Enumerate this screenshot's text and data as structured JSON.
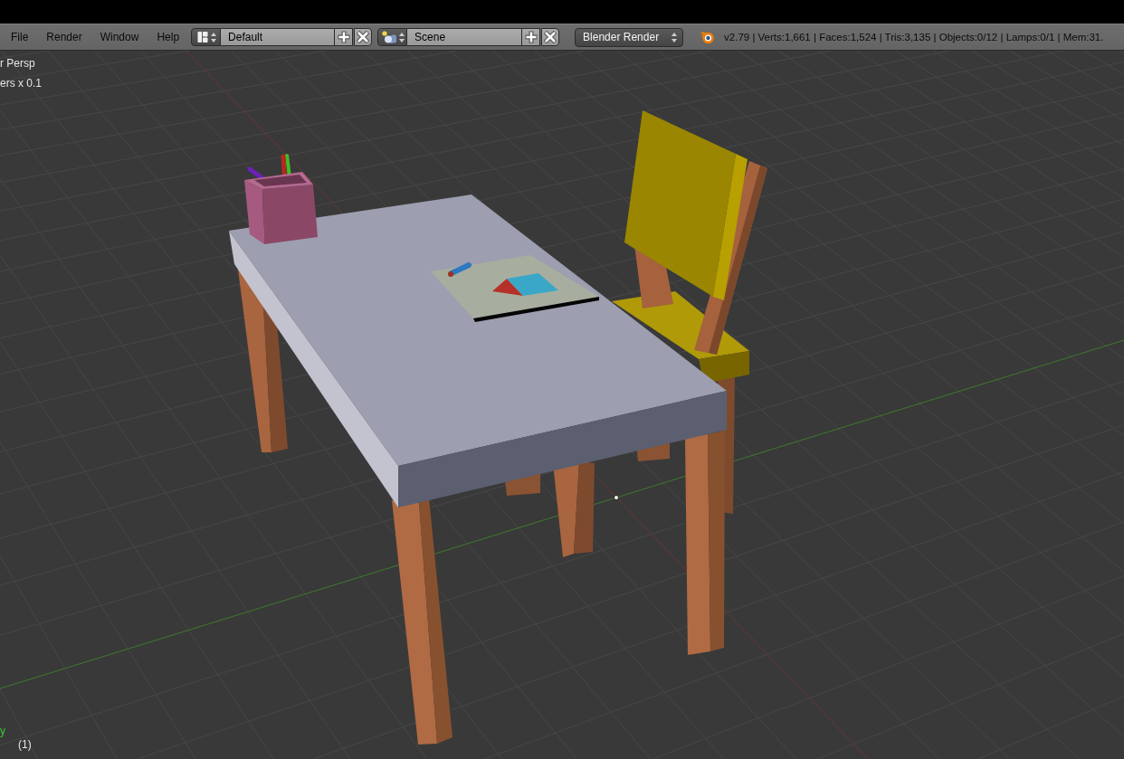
{
  "header": {
    "menus": [
      "File",
      "Render",
      "Window",
      "Help"
    ],
    "screen_layout": "Default",
    "scene": "Scene",
    "render_engine": "Blender Render",
    "stats": "v2.79 | Verts:1,661 | Faces:1,524 | Tris:3,135 | Objects:0/12 | Lamps:0/1 | Mem:31."
  },
  "viewport": {
    "view_name": "r Persp",
    "grid_scale": "ers x 0.1",
    "axis_label": "y",
    "frame_number": "(1)"
  }
}
